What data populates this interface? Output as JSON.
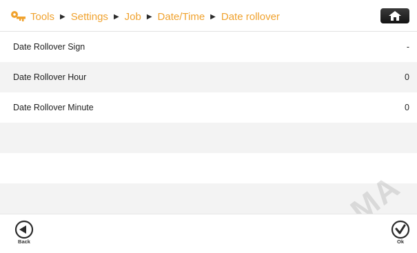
{
  "breadcrumb": [
    "Tools",
    "Settings",
    "Job",
    "Date/Time",
    "Date rollover"
  ],
  "rows": [
    {
      "label": "Date Rollover Sign",
      "value": "-"
    },
    {
      "label": "Date Rollover Hour",
      "value": "0"
    },
    {
      "label": "Date Rollover Minute",
      "value": "0"
    }
  ],
  "footer": {
    "back_label": "Back",
    "ok_label": "Ok"
  },
  "watermark": "MA",
  "icons": {
    "tools": "keys-icon",
    "home": "home-icon",
    "back": "back-arrow-icon",
    "ok": "checkmark-icon"
  },
  "colors": {
    "accent": "#f0a22e",
    "row_alt": "#f3f3f3",
    "home_button": "#1a1a1a"
  }
}
